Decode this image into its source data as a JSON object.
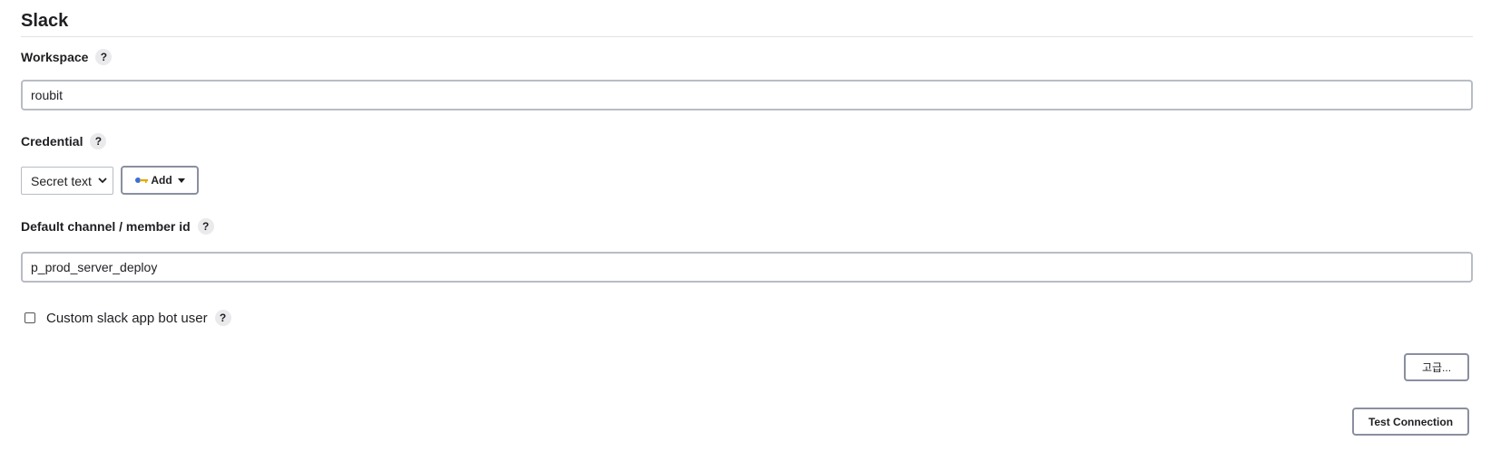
{
  "section": {
    "title": "Slack"
  },
  "help_icon_text": "?",
  "workspace": {
    "label": "Workspace",
    "value": "roubit"
  },
  "credential": {
    "label": "Credential",
    "selected": "Secret text",
    "add_label": "Add"
  },
  "channel": {
    "label": "Default channel / member id",
    "value": "p_prod_server_deploy"
  },
  "custom_bot": {
    "label": "Custom slack app bot user",
    "checked": false
  },
  "buttons": {
    "advanced": "고급...",
    "test_connection": "Test Connection"
  },
  "icons": {
    "help": "question-mark-icon",
    "key": "key-icon",
    "caret": "caret-down-icon",
    "chevron": "chevron-down-icon"
  }
}
